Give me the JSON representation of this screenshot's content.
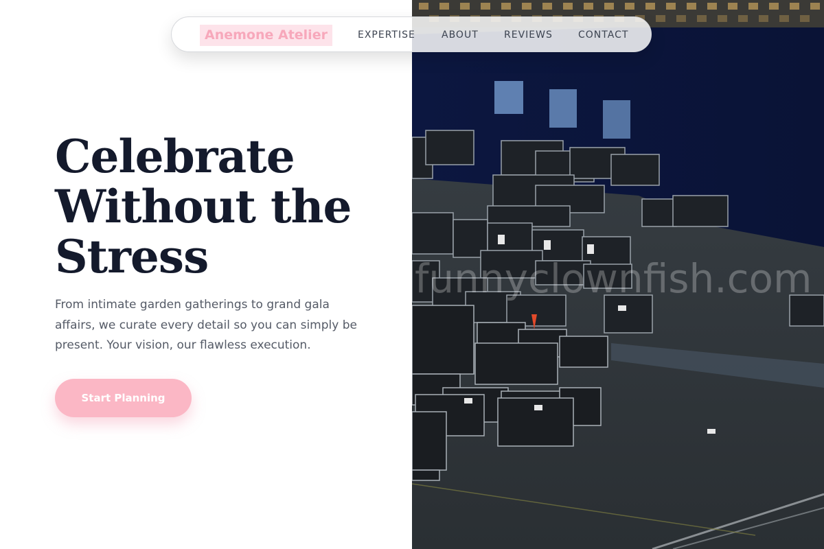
{
  "nav": {
    "brand": "Anemone Atelier",
    "links": [
      {
        "label": "EXPERTISE"
      },
      {
        "label": "ABOUT"
      },
      {
        "label": "REVIEWS"
      },
      {
        "label": "CONTACT"
      }
    ]
  },
  "hero": {
    "headline_lines": [
      "Celebrate",
      "Without the",
      "Stress"
    ],
    "subtext": "From intimate garden gatherings to grand gala affairs, we curate every detail so you can simply be present. Your vision, our flawless execution.",
    "cta_label": "Start Planning",
    "photo_watermark": "funnyclownfish.com"
  },
  "colors": {
    "brand_text": "#f7a8bb",
    "brand_highlight": "#fde3ea",
    "cta_background": "#fbb7c5",
    "headline": "#141a2c",
    "body_text": "#545a66"
  }
}
